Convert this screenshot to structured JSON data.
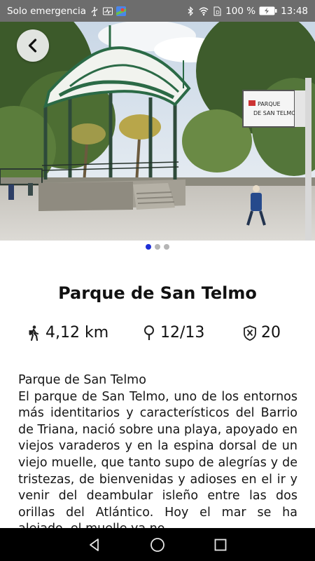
{
  "status_bar": {
    "carrier": "Solo emergencia",
    "battery_percent": "100 %",
    "time": "13:48"
  },
  "hero": {
    "sign_text_line1": "PARQUE",
    "sign_text_line2": "DE SAN TELMO"
  },
  "pager": {
    "total": 3,
    "active_index": 0
  },
  "place": {
    "title": "Parque de San Telmo",
    "distance": "4,12 km",
    "points": "12/13",
    "score": "20"
  },
  "description": {
    "heading": "Parque de San Telmo",
    "body": "El parque de San Telmo, uno de los entornos más identitarios y característicos del Barrio de Triana, nació sobre una playa, apoyado en viejos varaderos y en la espina dorsal de un viejo muelle, que tanto supo de alegrías y de tristezas, de bienvenidas y adioses en el ir y venir del deambular isleño entre las dos orillas del Atlántico. Hoy el mar se ha alejado, el muelle ya no"
  }
}
